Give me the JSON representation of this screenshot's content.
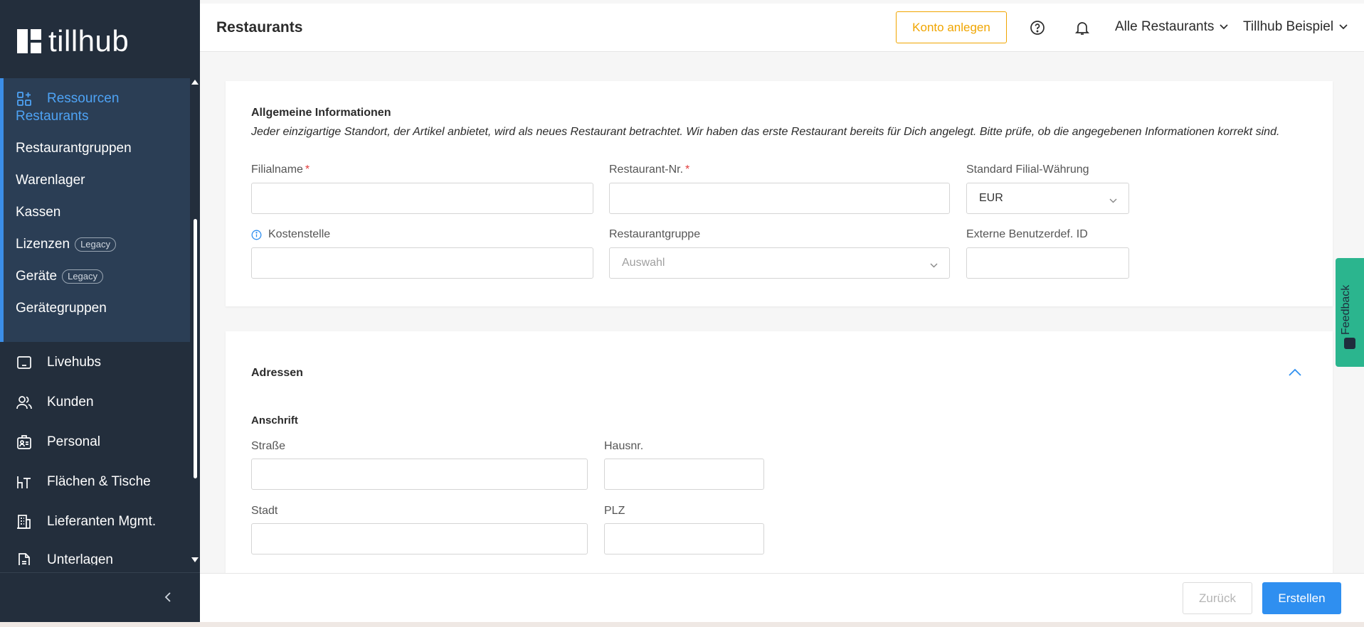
{
  "app": {
    "logo_text": "tillhub"
  },
  "sidebar": {
    "resources_label": "Ressourcen",
    "sub_items": [
      {
        "label": "Restaurants",
        "active": true
      },
      {
        "label": "Restaurantgruppen"
      },
      {
        "label": "Warenlager"
      },
      {
        "label": "Kassen"
      },
      {
        "label": "Lizenzen",
        "badge": "Legacy"
      },
      {
        "label": "Geräte",
        "badge": "Legacy"
      },
      {
        "label": "Gerätegruppen"
      }
    ],
    "items": [
      {
        "label": "Livehubs",
        "icon": "tablet-icon"
      },
      {
        "label": "Kunden",
        "icon": "users-icon"
      },
      {
        "label": "Personal",
        "icon": "id-badge-icon"
      },
      {
        "label": "Flächen & Tische",
        "icon": "table-chair-icon"
      },
      {
        "label": "Lieferanten Mgmt.",
        "icon": "building-icon"
      },
      {
        "label": "Unterlagen",
        "icon": "document-icon"
      }
    ]
  },
  "header": {
    "title": "Restaurants",
    "konto_button": "Konto anlegen",
    "restaurant_filter": "Alle Restaurants",
    "account_name": "Tillhub Beispiel"
  },
  "general": {
    "title": "Allgemeine Informationen",
    "description": "Jeder einzigartige Standort, der Artikel anbietet, wird als neues Restaurant betrachtet. Wir haben das erste Restaurant bereits für Dich angelegt. Bitte prüfe, ob die angegebenen Informationen korrekt sind.",
    "filialname_label": "Filialname",
    "restaurant_nr_label": "Restaurant-Nr.",
    "currency_label": "Standard Filial-Währung",
    "currency_value": "EUR",
    "kostenstelle_label": "Kostenstelle",
    "group_label": "Restaurantgruppe",
    "group_placeholder": "Auswahl",
    "external_id_label": "Externe Benutzerdef. ID",
    "required_mark": "*"
  },
  "addresses": {
    "title": "Adressen",
    "subtitle": "Anschrift",
    "street_label": "Straße",
    "house_label": "Hausnr.",
    "city_label": "Stadt",
    "zip_label": "PLZ"
  },
  "feedback": {
    "label": "Feedback"
  },
  "actions": {
    "back": "Zurück",
    "create": "Erstellen"
  },
  "colors": {
    "accent": "#2f8ff0",
    "warning": "#f0a500",
    "sidebar_bg": "#232e3c",
    "feedback": "#2bb58e"
  }
}
